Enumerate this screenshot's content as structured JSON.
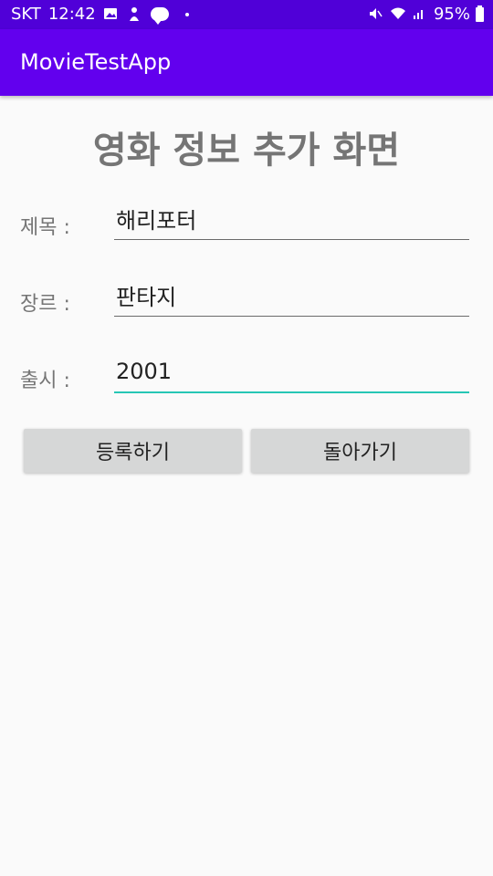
{
  "status_bar": {
    "carrier": "SKT",
    "time": "12:42",
    "battery": "95%",
    "left_icons": [
      "image-icon",
      "notification-icon",
      "talk-icon",
      "dot-icon"
    ],
    "right_icons": [
      "mute-icon",
      "wifi-icon",
      "signal-icon",
      "battery-icon"
    ]
  },
  "app_bar": {
    "title": "MovieTestApp",
    "color": "#6200ee"
  },
  "page": {
    "title": "영화 정보 추가 화면"
  },
  "form": {
    "title_label": "제목 :",
    "title_value": "해리포터",
    "genre_label": "장르 :",
    "genre_value": "판타지",
    "release_label": "출시 :",
    "release_value": "2001",
    "focused_field": "release",
    "accent_color": "#26c6b5"
  },
  "buttons": {
    "register_label": "등록하기",
    "back_label": "돌아가기"
  }
}
